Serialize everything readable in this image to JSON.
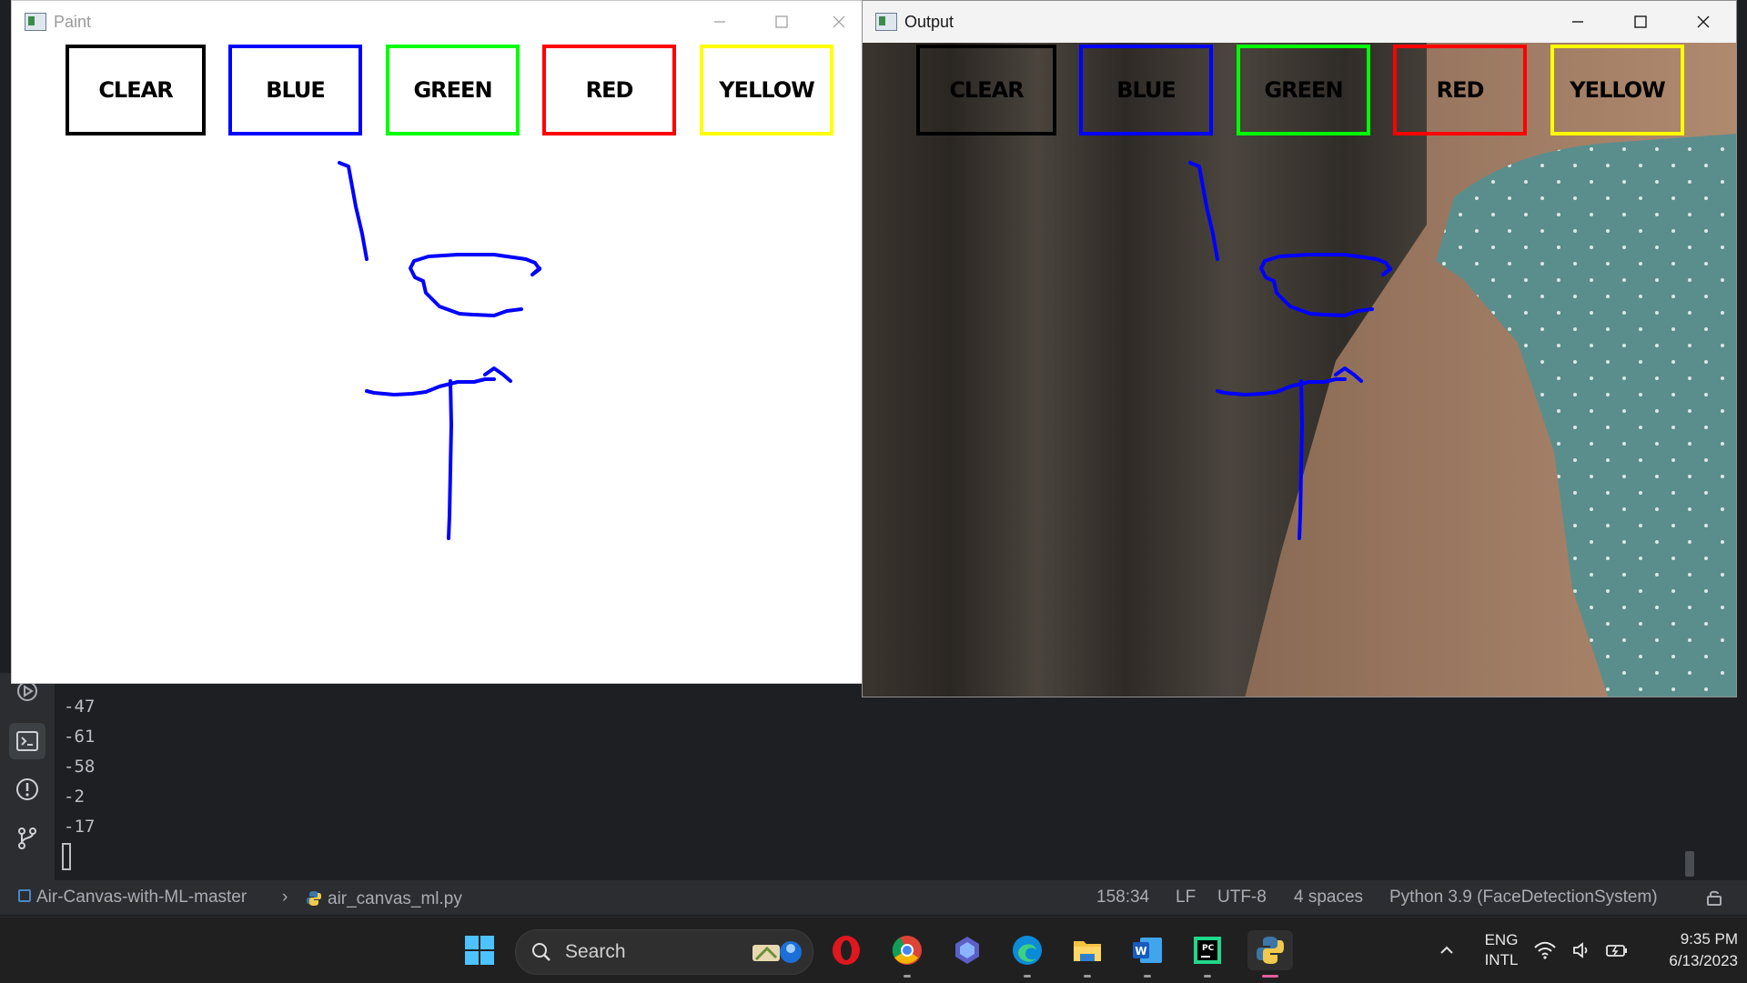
{
  "paint_window": {
    "title": "Paint"
  },
  "output_window": {
    "title": "Output"
  },
  "color_buttons": [
    {
      "label": "CLEAR",
      "color": "#000000"
    },
    {
      "label": "BLUE",
      "color": "#0000ff"
    },
    {
      "label": "GREEN",
      "color": "#00ff00"
    },
    {
      "label": "RED",
      "color": "#ff0000"
    },
    {
      "label": "YELLOW",
      "color": "#ffff00"
    }
  ],
  "stroke_color": "#0000ff",
  "console": {
    "lines": [
      "-47",
      "-61",
      "-58",
      "-2",
      "-17"
    ]
  },
  "left_rail_icons": [
    "run-icon",
    "terminal-icon",
    "problems-icon",
    "git-icon"
  ],
  "statusbar": {
    "project": "Air-Canvas-with-ML-master",
    "file": "air_canvas_ml.py",
    "position": "158:34",
    "line_ending": "LF",
    "encoding": "UTF-8",
    "indent": "4 spaces",
    "interpreter": "Python 3.9 (FaceDetectionSystem)"
  },
  "taskbar": {
    "search_label": "Search",
    "language": "ENG",
    "language_variant": "INTL",
    "time": "9:35 PM",
    "date": "6/13/2023",
    "apps": [
      "windows-start-icon",
      "opera-icon",
      "chrome-icon",
      "copilot-icon",
      "edge-icon",
      "file-explorer-icon",
      "word-icon",
      "pycharm-icon",
      "python-icon"
    ]
  }
}
